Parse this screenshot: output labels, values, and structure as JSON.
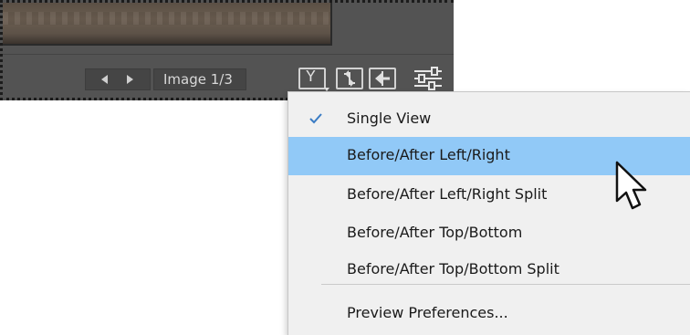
{
  "toolbar": {
    "prev_icon": "triangle-left-icon",
    "next_icon": "triangle-right-icon",
    "image_counter": "Image 1/3",
    "view_mode_icon": "before-after-view-icon",
    "swap_icon": "swap-before-after-icon",
    "copy_icon": "copy-to-after-icon",
    "preferences_icon": "sliders-icon"
  },
  "menu": {
    "items": [
      {
        "label": "Single View",
        "checked": true,
        "highlighted": false
      },
      {
        "label": "Before/After Left/Right",
        "checked": false,
        "highlighted": true
      },
      {
        "label": "Before/After Left/Right Split",
        "checked": false,
        "highlighted": false
      },
      {
        "label": "Before/After Top/Bottom",
        "checked": false,
        "highlighted": false
      },
      {
        "label": "Before/After Top/Bottom Split",
        "checked": false,
        "highlighted": false
      }
    ],
    "footer_item": {
      "label": "Preview Preferences..."
    }
  },
  "colors": {
    "panel_bg": "#535353",
    "menu_bg": "#f0f0f0",
    "highlight": "#91c9f7",
    "check": "#3a7cc4"
  }
}
